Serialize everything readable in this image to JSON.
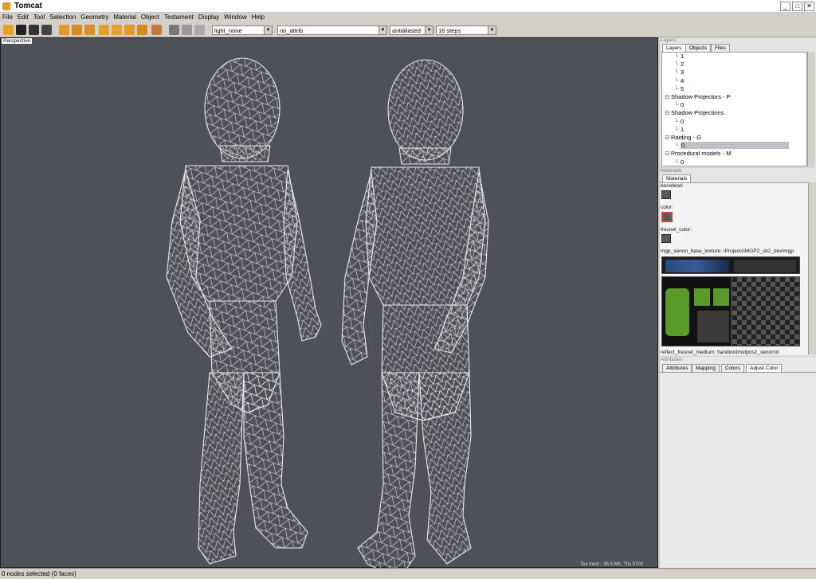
{
  "window": {
    "title": "Tomcat",
    "minimize": "_",
    "maximize": "□",
    "close": "✕"
  },
  "menu": [
    "File",
    "Edit",
    "Tool",
    "Selection",
    "Geometry",
    "Material",
    "Object",
    "Testament",
    "Display",
    "Window",
    "Help"
  ],
  "toolbar": {
    "light": "light_none",
    "attrib": "no_attrib",
    "aa": "antialiased",
    "steps": "16 steps"
  },
  "viewport": {
    "label": "Perspective",
    "texmem": "Tex mem : 35.5 Mb, Tris 9700"
  },
  "status": "0 nodes selected (0 faces)",
  "layers": {
    "header": "Layers",
    "tabs": [
      "Layers",
      "Objects",
      "Files"
    ],
    "items": [
      {
        "label": "1",
        "indent": 2
      },
      {
        "label": "2",
        "indent": 2
      },
      {
        "label": "3",
        "indent": 2
      },
      {
        "label": "4",
        "indent": 2
      },
      {
        "label": "5",
        "indent": 2
      },
      {
        "label": "Shadow Projectors - P",
        "indent": 1
      },
      {
        "label": "0",
        "indent": 2
      },
      {
        "label": "Shadow Projections",
        "indent": 1
      },
      {
        "label": "0",
        "indent": 2
      },
      {
        "label": "1",
        "indent": 2
      },
      {
        "label": "Raiding - G",
        "indent": 1
      },
      {
        "label": "0",
        "indent": 2,
        "selected": true
      },
      {
        "label": "Procedural models - M",
        "indent": 1
      },
      {
        "label": "0",
        "indent": 2
      }
    ]
  },
  "materials": {
    "header": "Materials",
    "tab": "Materials",
    "bonebind": "bonebind:",
    "color": "color:",
    "fresnel": "fresnel_color:",
    "texture": "mgp_xenon_base_texture: \\Projects\\MGP2_sb2_dev\\mgp",
    "reflect": "reflect_fresnel_medium: t\\andiordmotpos2_xenon\\rt"
  },
  "attributes": {
    "header": "Attributes",
    "tabs": [
      "Attributes",
      "Mapping",
      "Colors",
      "Adjust Color"
    ]
  },
  "colors": {
    "viewport": "#4f5158",
    "wire": "#e8e8e8",
    "accent": "#d0413f"
  }
}
